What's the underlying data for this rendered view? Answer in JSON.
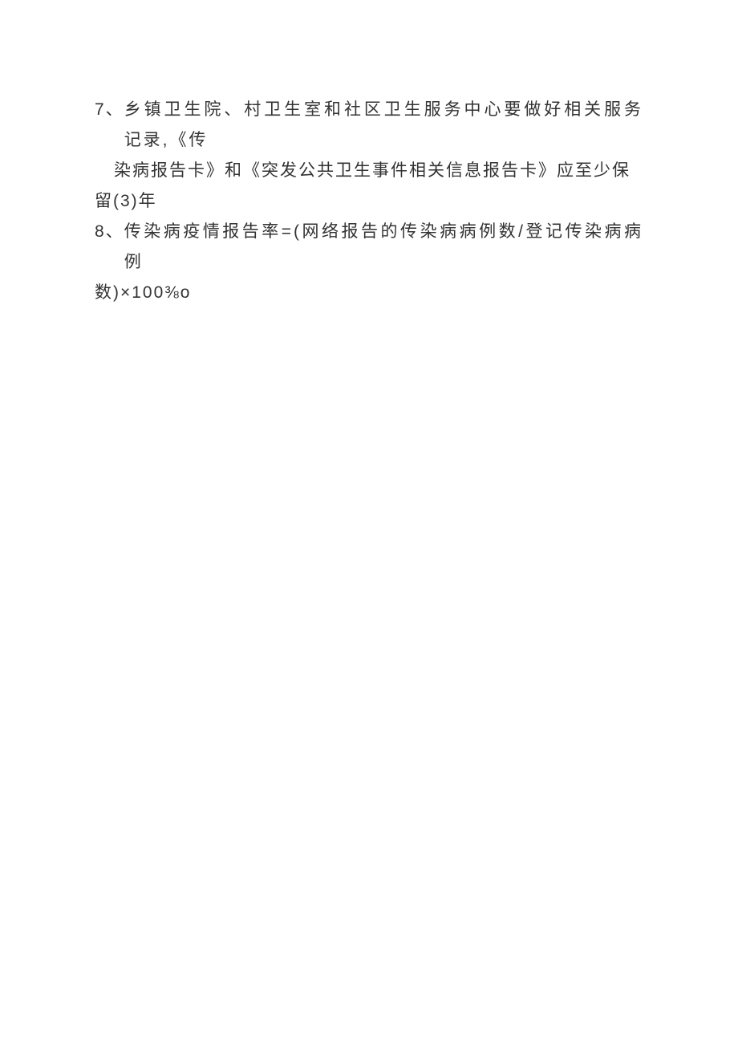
{
  "items": [
    {
      "number": "7、",
      "line1": "乡镇卫生院、村卫生室和社区卫生服务中心要做好相关服务记录,《传",
      "line2": "染病报告卡》和《突发公共卫生事件相关信息报告卡》应至少保",
      "line3": "留(3)年"
    },
    {
      "number": "8、",
      "line1": "传染病疫情报告率=(网络报告的传染病病例数/登记传染病病例",
      "line2": "数)×100⅜o"
    }
  ]
}
